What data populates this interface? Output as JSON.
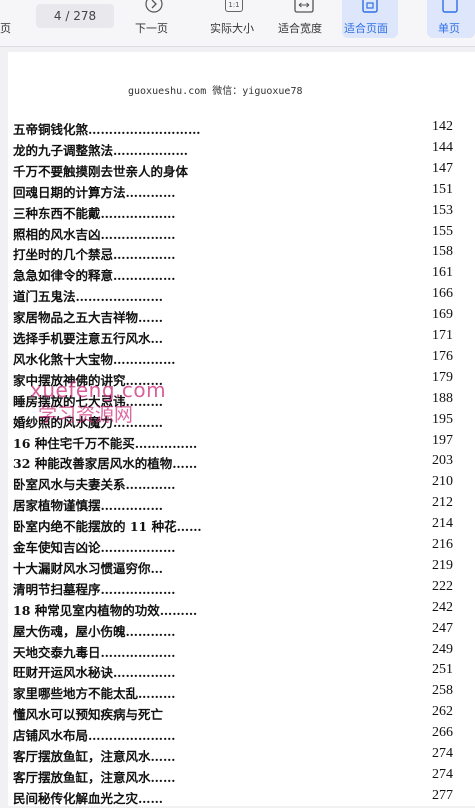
{
  "toolbar": {
    "first_label": "页",
    "page_current": "4",
    "page_total": "/ 278",
    "next_label": "下一页",
    "actual_size_label": "实际大小",
    "fit_width_label": "适合宽度",
    "fit_page_label": "适合页面",
    "single_label": "单页",
    "actual_size_icon": "1:1",
    "accent": "#2f6fe6",
    "active_bg": "#dde6fa"
  },
  "document": {
    "source_line": "guoxueshu.com  微信：yiguoxue78",
    "watermark_1": "xuefeng.com",
    "watermark_2": "学习资源网",
    "toc": [
      {
        "title": "五帝铜钱化煞………………………",
        "page": "142"
      },
      {
        "title": "龙的九子调整煞法………………",
        "page": "144"
      },
      {
        "title": "千万不要触摸刚去世亲人的身体",
        "page": "147"
      },
      {
        "title": "回魂日期的计算方法…………",
        "page": "151"
      },
      {
        "title": "三种东西不能戴………………",
        "page": "153"
      },
      {
        "title": "照相的风水吉凶………………",
        "page": "155"
      },
      {
        "title": "打坐时的几个禁忌……………",
        "page": "158"
      },
      {
        "title": "急急如律令的释意……………",
        "page": "161"
      },
      {
        "title": "道门五鬼法…………………",
        "page": "166"
      },
      {
        "title": "家居物品之五大吉祥物……",
        "page": "169"
      },
      {
        "title": "选择手机要注意五行风水…",
        "page": "171"
      },
      {
        "title": "风水化煞十大宝物……………",
        "page": "176"
      },
      {
        "title": "家中摆放神佛的讲究………",
        "page": "179"
      },
      {
        "title": "睡房摆放的七大忌讳………",
        "page": "188"
      },
      {
        "title": "婚纱照的风水魔力…………",
        "page": "195"
      },
      {
        "title": "16 种住宅千万不能买……………",
        "page": "197"
      },
      {
        "title": "32 种能改善家居风水的植物……",
        "page": "203"
      },
      {
        "title": "卧室风水与夫妻关系…………",
        "page": "210"
      },
      {
        "title": "居家植物谨慎摆……………",
        "page": "212"
      },
      {
        "title": "卧室内绝不能摆放的 11 种花……",
        "page": "214"
      },
      {
        "title": "金车使知吉凶论………………",
        "page": "216"
      },
      {
        "title": "十大漏财风水习惯逼穷你…",
        "page": "219"
      },
      {
        "title": "清明节扫墓程序………………",
        "page": "222"
      },
      {
        "title": "18 种常见室内植物的功效………",
        "page": "242"
      },
      {
        "title": "屋大伤魂，屋小伤魄…………",
        "page": "247"
      },
      {
        "title": "天地交泰九毒日………………",
        "page": "249"
      },
      {
        "title": "旺财开运风水秘诀……………",
        "page": "251"
      },
      {
        "title": "家里哪些地方不能太乱………",
        "page": "258"
      },
      {
        "title": "懂风水可以预知疾病与死亡",
        "page": "262"
      },
      {
        "title": "店铺风水布局…………………",
        "page": "266"
      },
      {
        "title": "客厅摆放鱼缸，注意风水……",
        "page": "274"
      },
      {
        "title": "客厅摆放鱼缸，注意风水……",
        "page": "274"
      },
      {
        "title": "民间秘传化解血光之灾……",
        "page": "277"
      }
    ]
  }
}
